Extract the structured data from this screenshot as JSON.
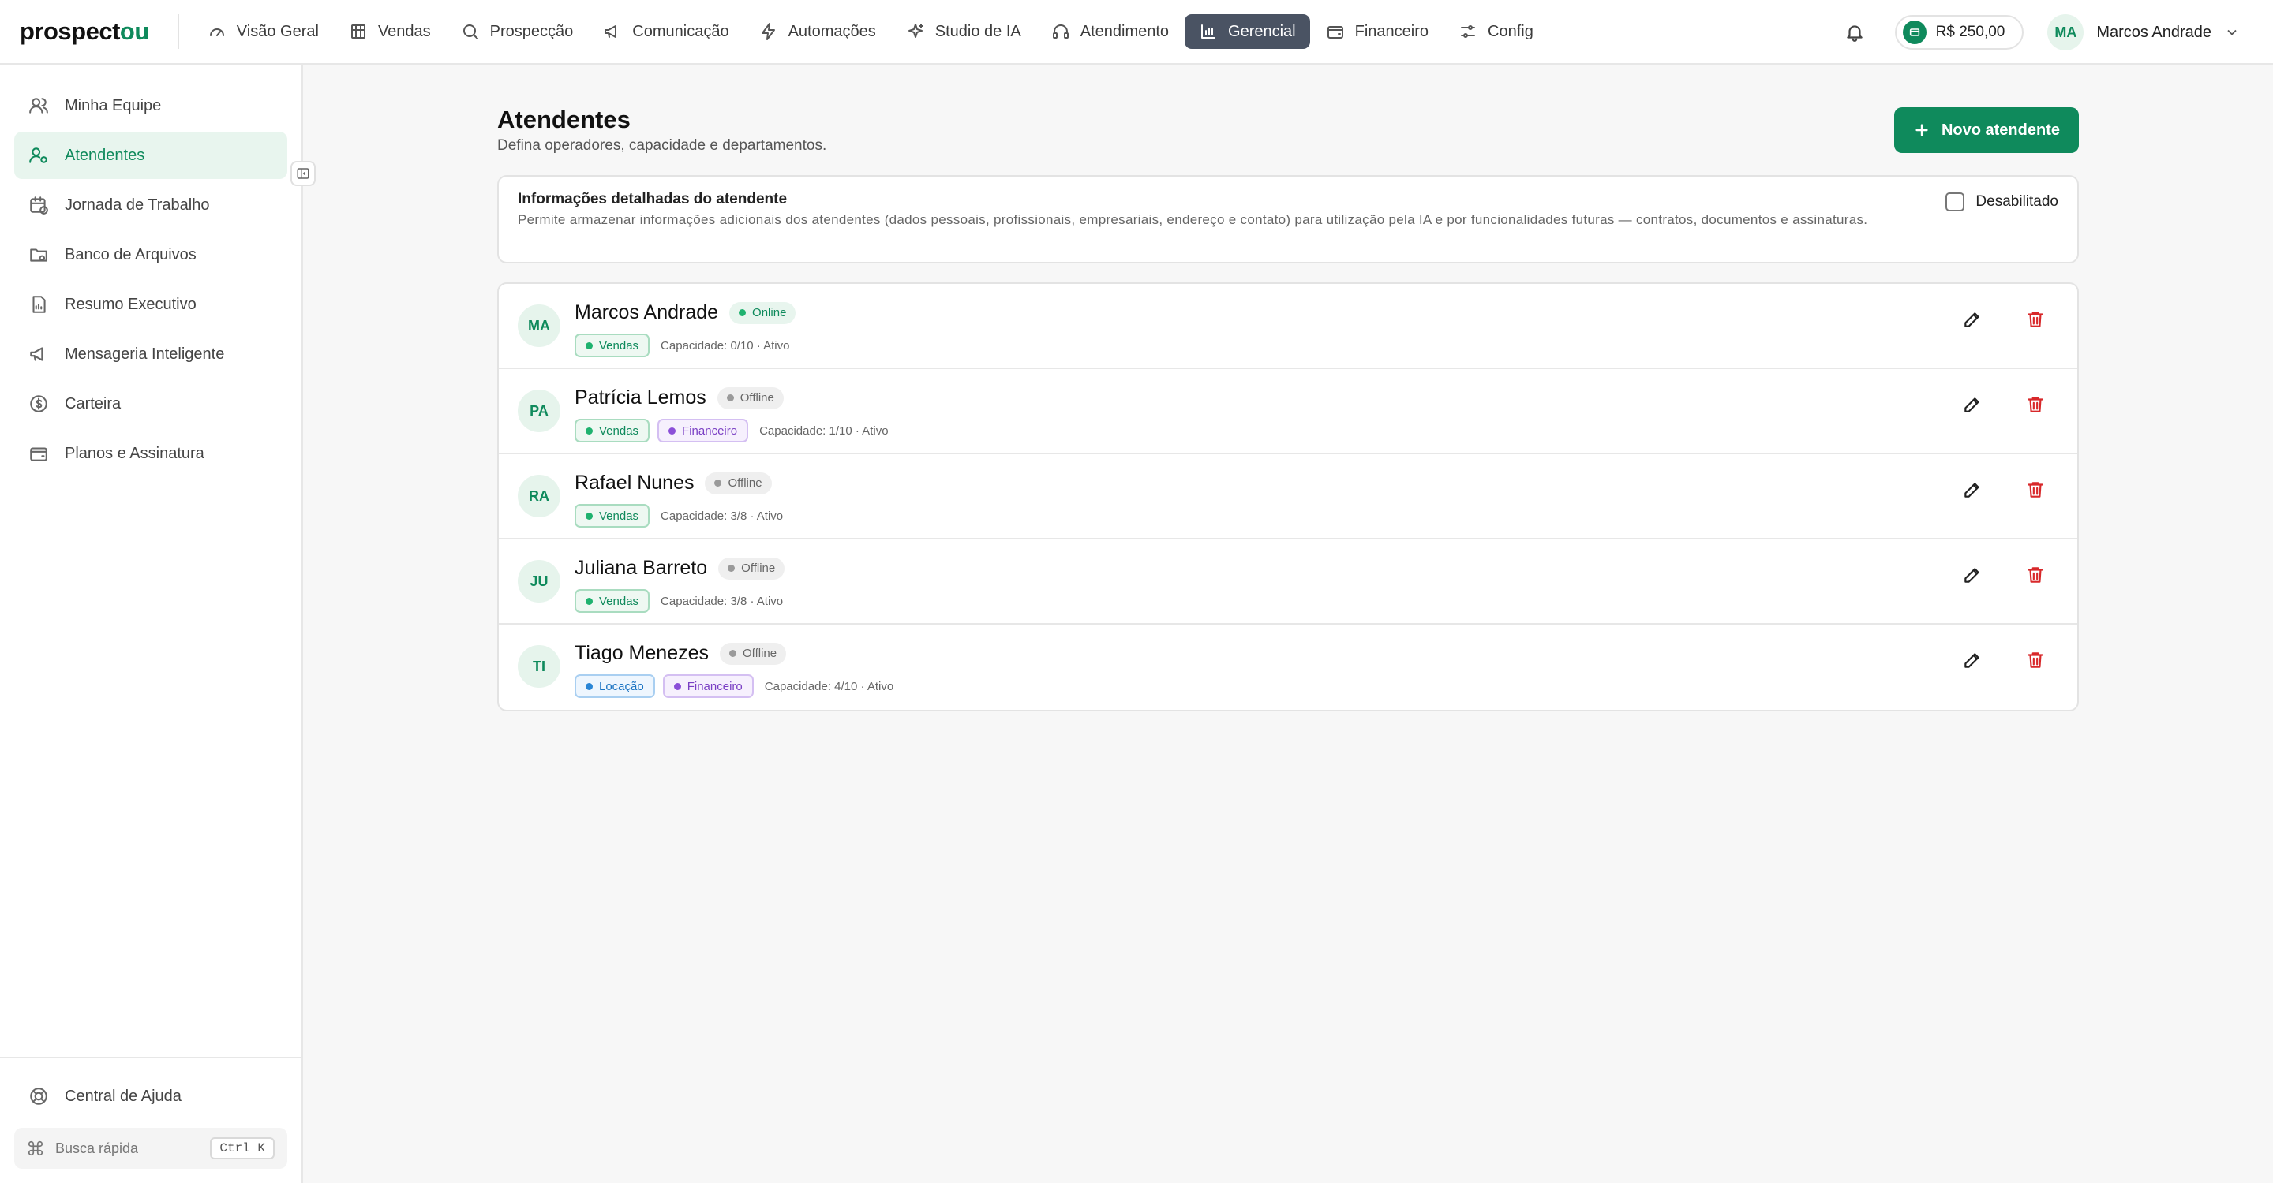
{
  "brand": {
    "part1": "prospect",
    "part2": "ou"
  },
  "nav": [
    {
      "label": "Visão Geral",
      "icon": "gauge-icon",
      "active": false
    },
    {
      "label": "Vendas",
      "icon": "building-icon",
      "active": false
    },
    {
      "label": "Prospecção",
      "icon": "search-icon",
      "active": false
    },
    {
      "label": "Comunicação",
      "icon": "megaphone-icon",
      "active": false
    },
    {
      "label": "Automações",
      "icon": "lightning-icon",
      "active": false
    },
    {
      "label": "Studio de IA",
      "icon": "sparkles-icon",
      "active": false
    },
    {
      "label": "Atendimento",
      "icon": "headset-icon",
      "active": false
    },
    {
      "label": "Gerencial",
      "icon": "bar-chart-icon",
      "active": true
    },
    {
      "label": "Financeiro",
      "icon": "wallet-icon",
      "active": false
    },
    {
      "label": "Config",
      "icon": "sliders-icon",
      "active": false
    }
  ],
  "header": {
    "balance": "R$ 250,00",
    "user_initials": "MA",
    "user_name": "Marcos Andrade"
  },
  "sidebar": {
    "items": [
      {
        "label": "Minha Equipe",
        "icon": "users-icon",
        "active": false
      },
      {
        "label": "Atendentes",
        "icon": "user-cog-icon",
        "active": true
      },
      {
        "label": "Jornada de Trabalho",
        "icon": "calendar-clock-icon",
        "active": false
      },
      {
        "label": "Banco de Arquivos",
        "icon": "folder-icon",
        "active": false
      },
      {
        "label": "Resumo Executivo",
        "icon": "report-icon",
        "active": false
      },
      {
        "label": "Mensageria Inteligente",
        "icon": "megaphone-icon",
        "active": false
      },
      {
        "label": "Carteira",
        "icon": "dollar-circle-icon",
        "active": false
      },
      {
        "label": "Planos e Assinatura",
        "icon": "wallet-icon",
        "active": false
      }
    ],
    "help_label": "Central de Ajuda",
    "quick_search_label": "Busca rápida",
    "quick_search_shortcut": "Ctrl K"
  },
  "page": {
    "title": "Atendentes",
    "subtitle": "Defina operadores, capacidade e departamentos.",
    "new_button_label": "Novo atendente"
  },
  "info_card": {
    "title": "Informações detalhadas do atendente",
    "description": "Permite armazenar informações adicionais dos atendentes (dados pessoais, profissionais, empresariais, endereço e contato) para utilização pela IA e por funcionalidades futuras — contratos, documentos e assinaturas.",
    "toggle_label": "Desabilitado"
  },
  "attendants": [
    {
      "initials": "MA",
      "name": "Marcos Andrade",
      "status": "Online",
      "online": true,
      "tags": [
        {
          "label": "Vendas",
          "color": "green"
        }
      ],
      "meta": "Capacidade: 0/10 · Ativo"
    },
    {
      "initials": "PA",
      "name": "Patrícia Lemos",
      "status": "Offline",
      "online": false,
      "tags": [
        {
          "label": "Vendas",
          "color": "green"
        },
        {
          "label": "Financeiro",
          "color": "purple"
        }
      ],
      "meta": "Capacidade: 1/10 · Ativo"
    },
    {
      "initials": "RA",
      "name": "Rafael Nunes",
      "status": "Offline",
      "online": false,
      "tags": [
        {
          "label": "Vendas",
          "color": "green"
        }
      ],
      "meta": "Capacidade: 3/8 · Ativo"
    },
    {
      "initials": "JU",
      "name": "Juliana Barreto",
      "status": "Offline",
      "online": false,
      "tags": [
        {
          "label": "Vendas",
          "color": "green"
        }
      ],
      "meta": "Capacidade: 3/8 · Ativo"
    },
    {
      "initials": "TI",
      "name": "Tiago Menezes",
      "status": "Offline",
      "online": false,
      "tags": [
        {
          "label": "Locação",
          "color": "blue"
        },
        {
          "label": "Financeiro",
          "color": "purple"
        }
      ],
      "meta": "Capacidade: 4/10 · Ativo"
    }
  ],
  "colors": {
    "brand": "#0f8a5c",
    "nav_active": "#4a5363",
    "danger": "#d8282a"
  }
}
